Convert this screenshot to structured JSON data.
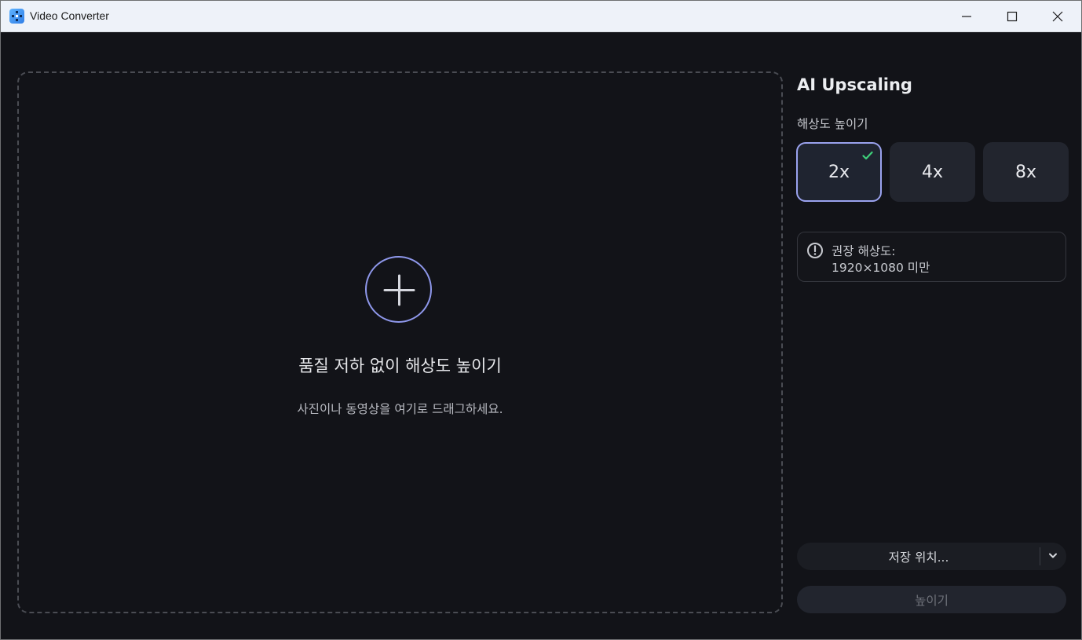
{
  "window": {
    "title": "Video Converter",
    "icons": {
      "app": "app-logo-icon",
      "minimize": "minimize-icon",
      "maximize": "maximize-icon",
      "close": "close-icon"
    }
  },
  "dropzone": {
    "icon": "plus-circle-icon",
    "title": "품질 저하 없이 해상도 높이기",
    "subtitle": "사진이나 동영상을 여기로 드래그하세요."
  },
  "panel": {
    "title": "AI Upscaling",
    "scale_label": "해상도 높이기",
    "scales": [
      {
        "label": "2x",
        "selected": true
      },
      {
        "label": "4x",
        "selected": false
      },
      {
        "label": "8x",
        "selected": false
      }
    ],
    "info": {
      "icon": "exclamation-circle-icon",
      "line1": "권장 해상도:",
      "line2": "1920×1080 미만"
    },
    "save_location": {
      "label": "저장 위치...",
      "icon": "chevron-down-icon"
    },
    "upscale_button": {
      "label": "높이기",
      "enabled": false
    }
  },
  "colors": {
    "background": "#121318",
    "accent": "#9aa2ee",
    "check": "#3ecf7a",
    "button": "#22252e"
  }
}
